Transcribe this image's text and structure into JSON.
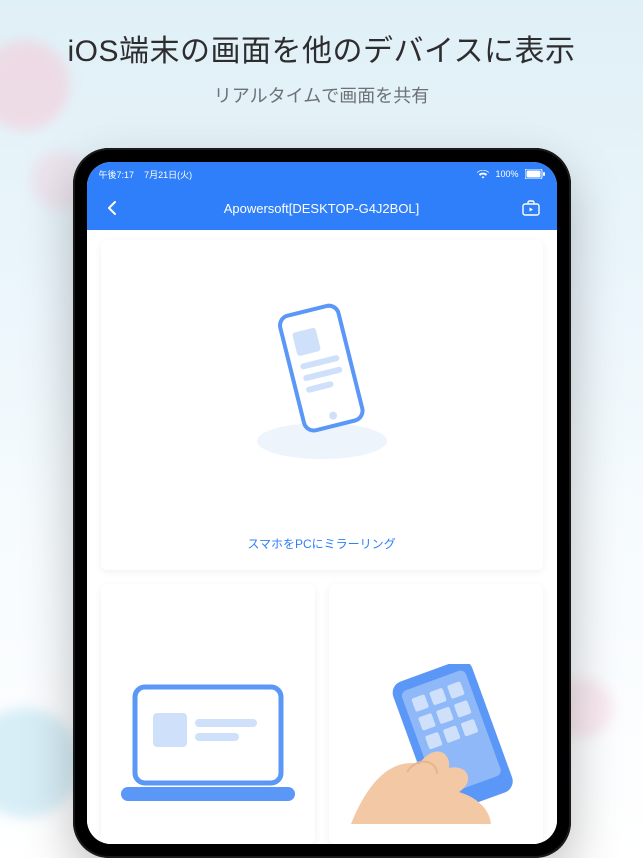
{
  "hero": {
    "title": "iOS端末の画面を他のデバイスに表示",
    "subtitle": "リアルタイムで画面を共有"
  },
  "statusbar": {
    "time": "午後7:17",
    "date": "7月21日(火)",
    "battery": "100%"
  },
  "navbar": {
    "title": "Apowersoft[DESKTOP-G4J2BOL]"
  },
  "cards": {
    "main_caption": "スマホをPCにミラーリング"
  },
  "colors": {
    "accent": "#2f7ffb"
  }
}
